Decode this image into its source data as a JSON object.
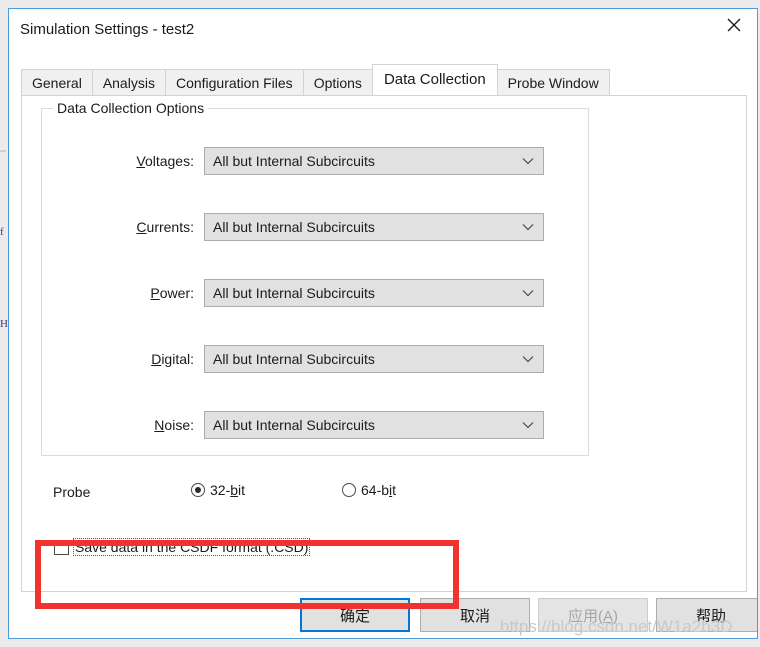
{
  "window": {
    "title": "Simulation Settings - test2",
    "close_icon": "close-icon"
  },
  "tabs": [
    {
      "label": "General",
      "active": false
    },
    {
      "label": "Analysis",
      "active": false
    },
    {
      "label": "Configuration Files",
      "active": false
    },
    {
      "label": "Options",
      "active": false
    },
    {
      "label": "Data Collection",
      "active": true
    },
    {
      "label": "Probe Window",
      "active": false
    }
  ],
  "groupbox": {
    "title": "Data Collection Options",
    "fields": [
      {
        "label_pre": "",
        "label_key": "V",
        "label_post": "oltages:",
        "value": "All but Internal Subcircuits"
      },
      {
        "label_pre": "",
        "label_key": "C",
        "label_post": "urrents:",
        "value": "All but Internal Subcircuits"
      },
      {
        "label_pre": "",
        "label_key": "P",
        "label_post": "ower:",
        "value": "All but Internal Subcircuits"
      },
      {
        "label_pre": "",
        "label_key": "D",
        "label_post": "igital:",
        "value": "All but Internal Subcircuits"
      },
      {
        "label_pre": "",
        "label_key": "N",
        "label_post": "oise:",
        "value": "All but Internal Subcircuits"
      }
    ]
  },
  "probe": {
    "label": "Probe",
    "options": [
      {
        "pre": "32-",
        "key": "b",
        "post": "it",
        "selected": true
      },
      {
        "pre": "64-b",
        "key": "i",
        "post": "t",
        "selected": false
      }
    ]
  },
  "csdf": {
    "label": "Save data in the CSDF format (.CSD)",
    "checked": false
  },
  "buttons": [
    {
      "pre": "确定",
      "key": "",
      "post": "",
      "state": "default"
    },
    {
      "pre": "取消",
      "key": "",
      "post": "",
      "state": "normal"
    },
    {
      "pre": "应用(",
      "key": "A",
      "post": ")",
      "state": "disabled"
    },
    {
      "pre": "帮助",
      "key": "",
      "post": "",
      "state": "normal"
    }
  ],
  "watermark": "https://blog.csdn.net/W1a2b3D",
  "colors": {
    "annotation": "#f2322c",
    "default_button_border": "#0078d7",
    "dialog_border": "#4b9cd8"
  }
}
